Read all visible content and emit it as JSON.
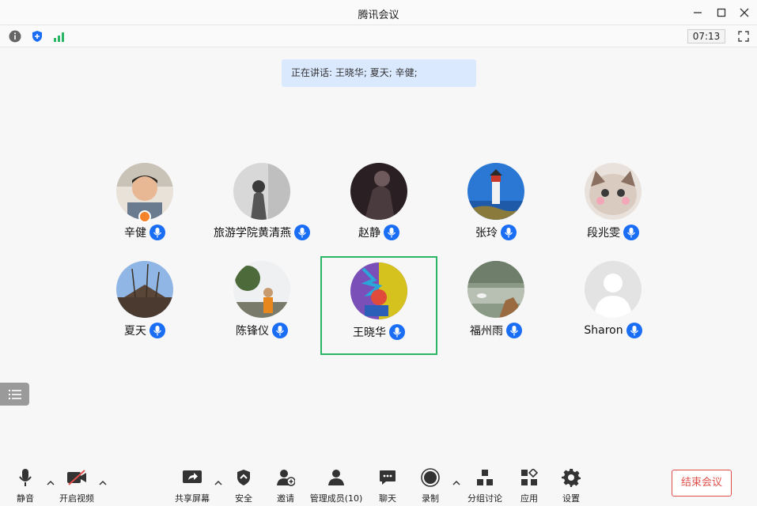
{
  "window": {
    "title": "腾讯会议"
  },
  "infobar": {
    "timer": "07:13"
  },
  "speaking": {
    "text": "正在讲话: 王晓华; 夏天; 辛健;"
  },
  "participants": [
    {
      "name": "辛健"
    },
    {
      "name": "旅游学院黄清燕"
    },
    {
      "name": "赵静"
    },
    {
      "name": "张玲"
    },
    {
      "name": "段兆雯"
    },
    {
      "name": "夏天"
    },
    {
      "name": "陈锋仪"
    },
    {
      "name": "王晓华"
    },
    {
      "name": "福州雨"
    },
    {
      "name": "Sharon"
    }
  ],
  "toolbar": {
    "mute": "静音",
    "video": "开启视频",
    "share": "共享屏幕",
    "security": "安全",
    "invite": "邀请",
    "members": "管理成员(10)",
    "chat": "聊天",
    "record": "录制",
    "breakout": "分组讨论",
    "apps": "应用",
    "settings": "设置",
    "end": "结束会议"
  },
  "colors": {
    "accent": "#1a6ef5",
    "active_border": "#2bb665",
    "end": "#e0504a",
    "speaking_bg": "#dbe9ff"
  }
}
